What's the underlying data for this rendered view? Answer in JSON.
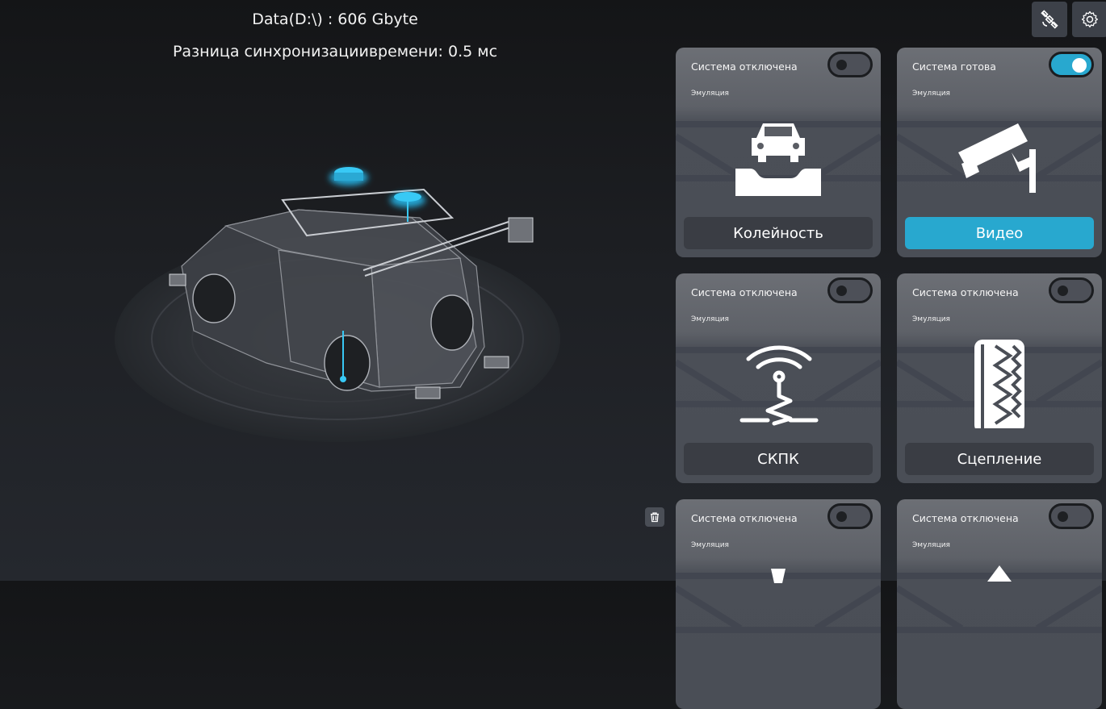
{
  "header": {
    "disk_info": "Data(D:\\) : 606 Gbyte",
    "sync_info": "Разница синхронизациивремени: 0.5 мс"
  },
  "toolbar": {
    "satellite_icon": "satellite-icon",
    "settings_icon": "gear-icon"
  },
  "colors": {
    "accent": "#28a8cf",
    "card": "#4a4e56",
    "button": "#3a3d44"
  },
  "cards": [
    {
      "status": "Система отключена",
      "mode": "Эмуляция",
      "label": "Колейность",
      "enabled": false,
      "icon": "car-rut-icon"
    },
    {
      "status": "Система готова",
      "mode": "Эмуляция",
      "label": "Видео",
      "enabled": true,
      "icon": "camera-icon"
    },
    {
      "status": "Система отключена",
      "mode": "Эмуляция",
      "label": "СКПК",
      "enabled": false,
      "icon": "signal-sensor-icon"
    },
    {
      "status": "Система отключена",
      "mode": "Эмуляция",
      "label": "Сцепление",
      "enabled": false,
      "icon": "tire-icon"
    },
    {
      "status": "Система отключена",
      "mode": "Эмуляция",
      "label": "",
      "enabled": false,
      "icon": "sensor-icon"
    },
    {
      "status": "Система отключена",
      "mode": "Эмуляция",
      "label": "",
      "enabled": false,
      "icon": "arrow-icon"
    }
  ]
}
